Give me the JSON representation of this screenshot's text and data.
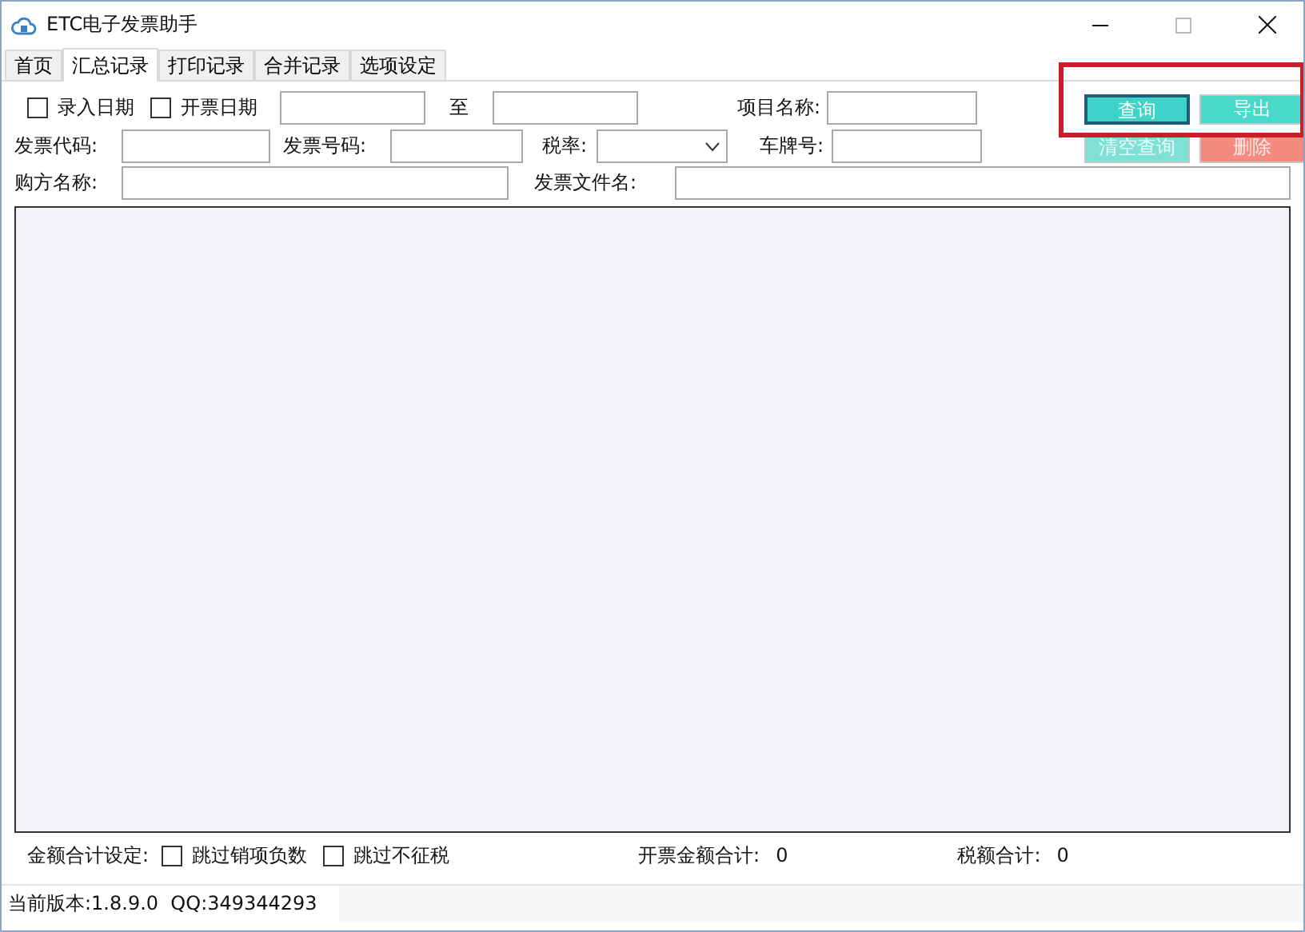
{
  "window": {
    "title": "ETC电子发票助手"
  },
  "tabs": [
    {
      "label": "首页",
      "selected": false
    },
    {
      "label": "汇总记录",
      "selected": true
    },
    {
      "label": "打印记录",
      "selected": false
    },
    {
      "label": "合并记录",
      "selected": false
    },
    {
      "label": "选项设定",
      "selected": false
    }
  ],
  "filters": {
    "date_checks": [
      {
        "label": "录入日期",
        "checked": false
      },
      {
        "label": "开票日期",
        "checked": false
      }
    ],
    "date_separator": "至",
    "item_name": {
      "label": "项目名称:"
    },
    "invoice_code": {
      "label": "发票代码:"
    },
    "invoice_number": {
      "label": "发票号码:"
    },
    "tax_rate": {
      "label": "税率:"
    },
    "plate_number": {
      "label": "车牌号:"
    },
    "buyer_name": {
      "label": "购方名称:"
    },
    "file_name": {
      "label": "发票文件名:"
    }
  },
  "buttons": [
    {
      "label": "查询",
      "kind": "query"
    },
    {
      "label": "导出",
      "kind": "export"
    },
    {
      "label": "清空查询",
      "kind": "clear"
    },
    {
      "label": "删除",
      "kind": "delete"
    }
  ],
  "annotation": {
    "kind": "frame"
  },
  "footer": {
    "setting_label": "金额合计设定:",
    "checks": [
      {
        "label": "跳过销项负数",
        "checked": false
      },
      {
        "label": "跳过不征税",
        "checked": false
      }
    ],
    "totals": [
      {
        "label": "开票金额合计:",
        "value": "0"
      },
      {
        "label": "税额合计:",
        "value": "0"
      }
    ]
  },
  "status_bar": {
    "version": "当前版本:1.8.9.0",
    "qq": "QQ:349344293"
  }
}
